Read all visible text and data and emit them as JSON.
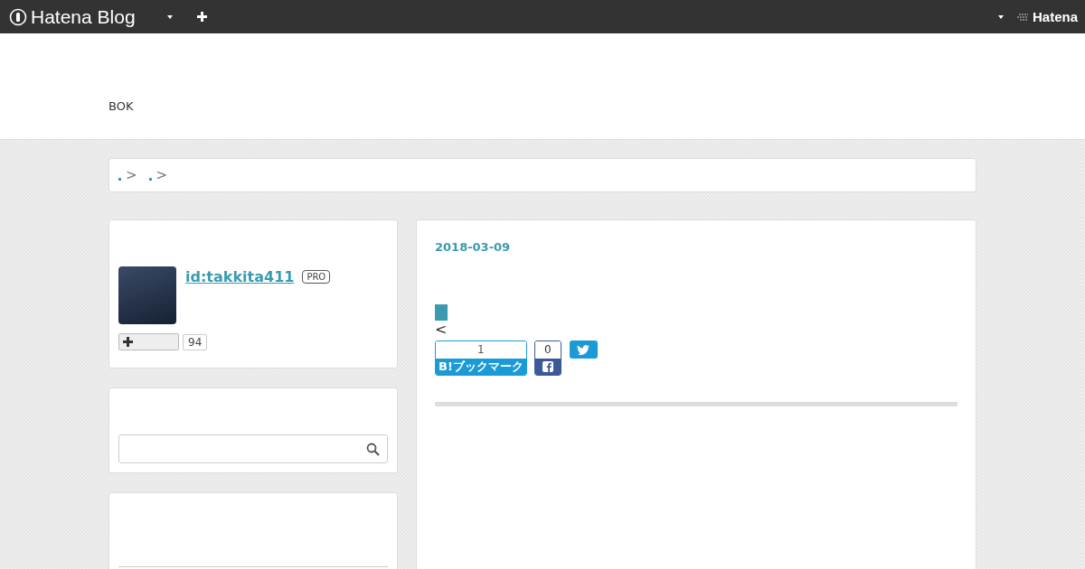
{
  "topbar": {
    "logo": "Hatena Blog",
    "right_logo": "Hatena"
  },
  "header": {
    "blog_title": "BOK"
  },
  "breadcrumb": {
    "separators": [
      ">",
      ">"
    ]
  },
  "profile": {
    "user_id": "id:takkita411",
    "badge": "PRO",
    "subscribers": "94"
  },
  "entry": {
    "date": "2018-03-09",
    "back_link": "<",
    "bookmark": {
      "count": "1",
      "label": "B!ブックマーク"
    },
    "facebook": {
      "count": "0"
    }
  }
}
